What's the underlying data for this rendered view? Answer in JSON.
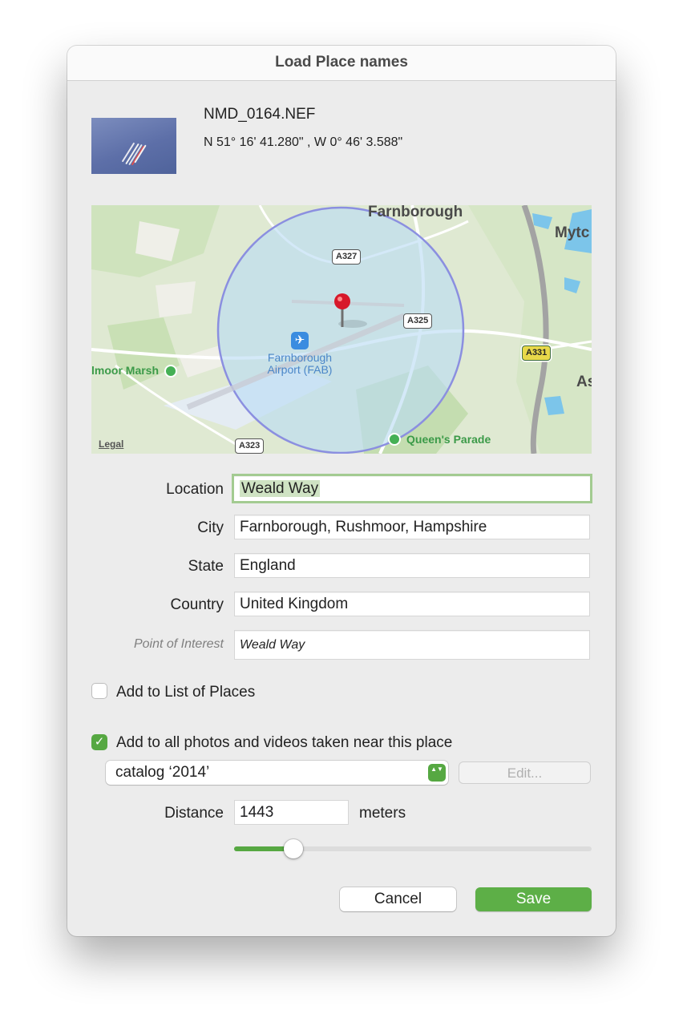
{
  "dialog": {
    "title": "Load Place names"
  },
  "photo": {
    "thumbnail_icon": "photo-thumbnail-icon",
    "filename": "NMD_0164.NEF",
    "coordinates": "N 51° 16' 41.280\" , W 0° 46' 3.588\""
  },
  "map": {
    "labels": {
      "farnborough": "Farnborough",
      "mytchett": "Mytc",
      "ash": "As",
      "airport": "Farnborough Airport (FAB)",
      "marsh": "lmoor Marsh",
      "queens_parade": "Queen's Parade",
      "legal": "Legal"
    },
    "roads": {
      "a327": "A327",
      "a325": "A325",
      "a331": "A331",
      "a323": "A323"
    },
    "radius_meters": 1443,
    "colors": {
      "radius_fill": "#b9dcf4",
      "radius_stroke": "#8b8fe0",
      "pin": "#d7182a"
    },
    "icons": {
      "pin": "map-pin-icon",
      "airport": "airplane-icon",
      "poi": "park-pin-icon"
    }
  },
  "form": {
    "location": {
      "label": "Location",
      "value": "Weald Way"
    },
    "city": {
      "label": "City",
      "value": "Farnborough, Rushmoor, Hampshire"
    },
    "state": {
      "label": "State",
      "value": "England"
    },
    "country": {
      "label": "Country",
      "value": "United Kingdom"
    },
    "poi": {
      "label": "Point of Interest",
      "value": "Weald Way"
    }
  },
  "options": {
    "add_to_list": {
      "label": "Add to List of Places",
      "checked": false
    },
    "add_to_nearby": {
      "label": "Add to all photos and videos taken near this place",
      "checked": true,
      "check_glyph": "✓"
    }
  },
  "catalog": {
    "selected": "catalog ‘2014’",
    "arrows": "▲▼"
  },
  "buttons": {
    "edit": "Edit...",
    "cancel": "Cancel",
    "save": "Save"
  },
  "distance": {
    "label": "Distance",
    "value": "1443",
    "unit": "meters",
    "slider_fraction": 0.165
  },
  "colors": {
    "accent": "#56a842",
    "save_button": "#5daf47",
    "focus_ring": "#a3cb91",
    "dialog_bg": "#ececec"
  }
}
